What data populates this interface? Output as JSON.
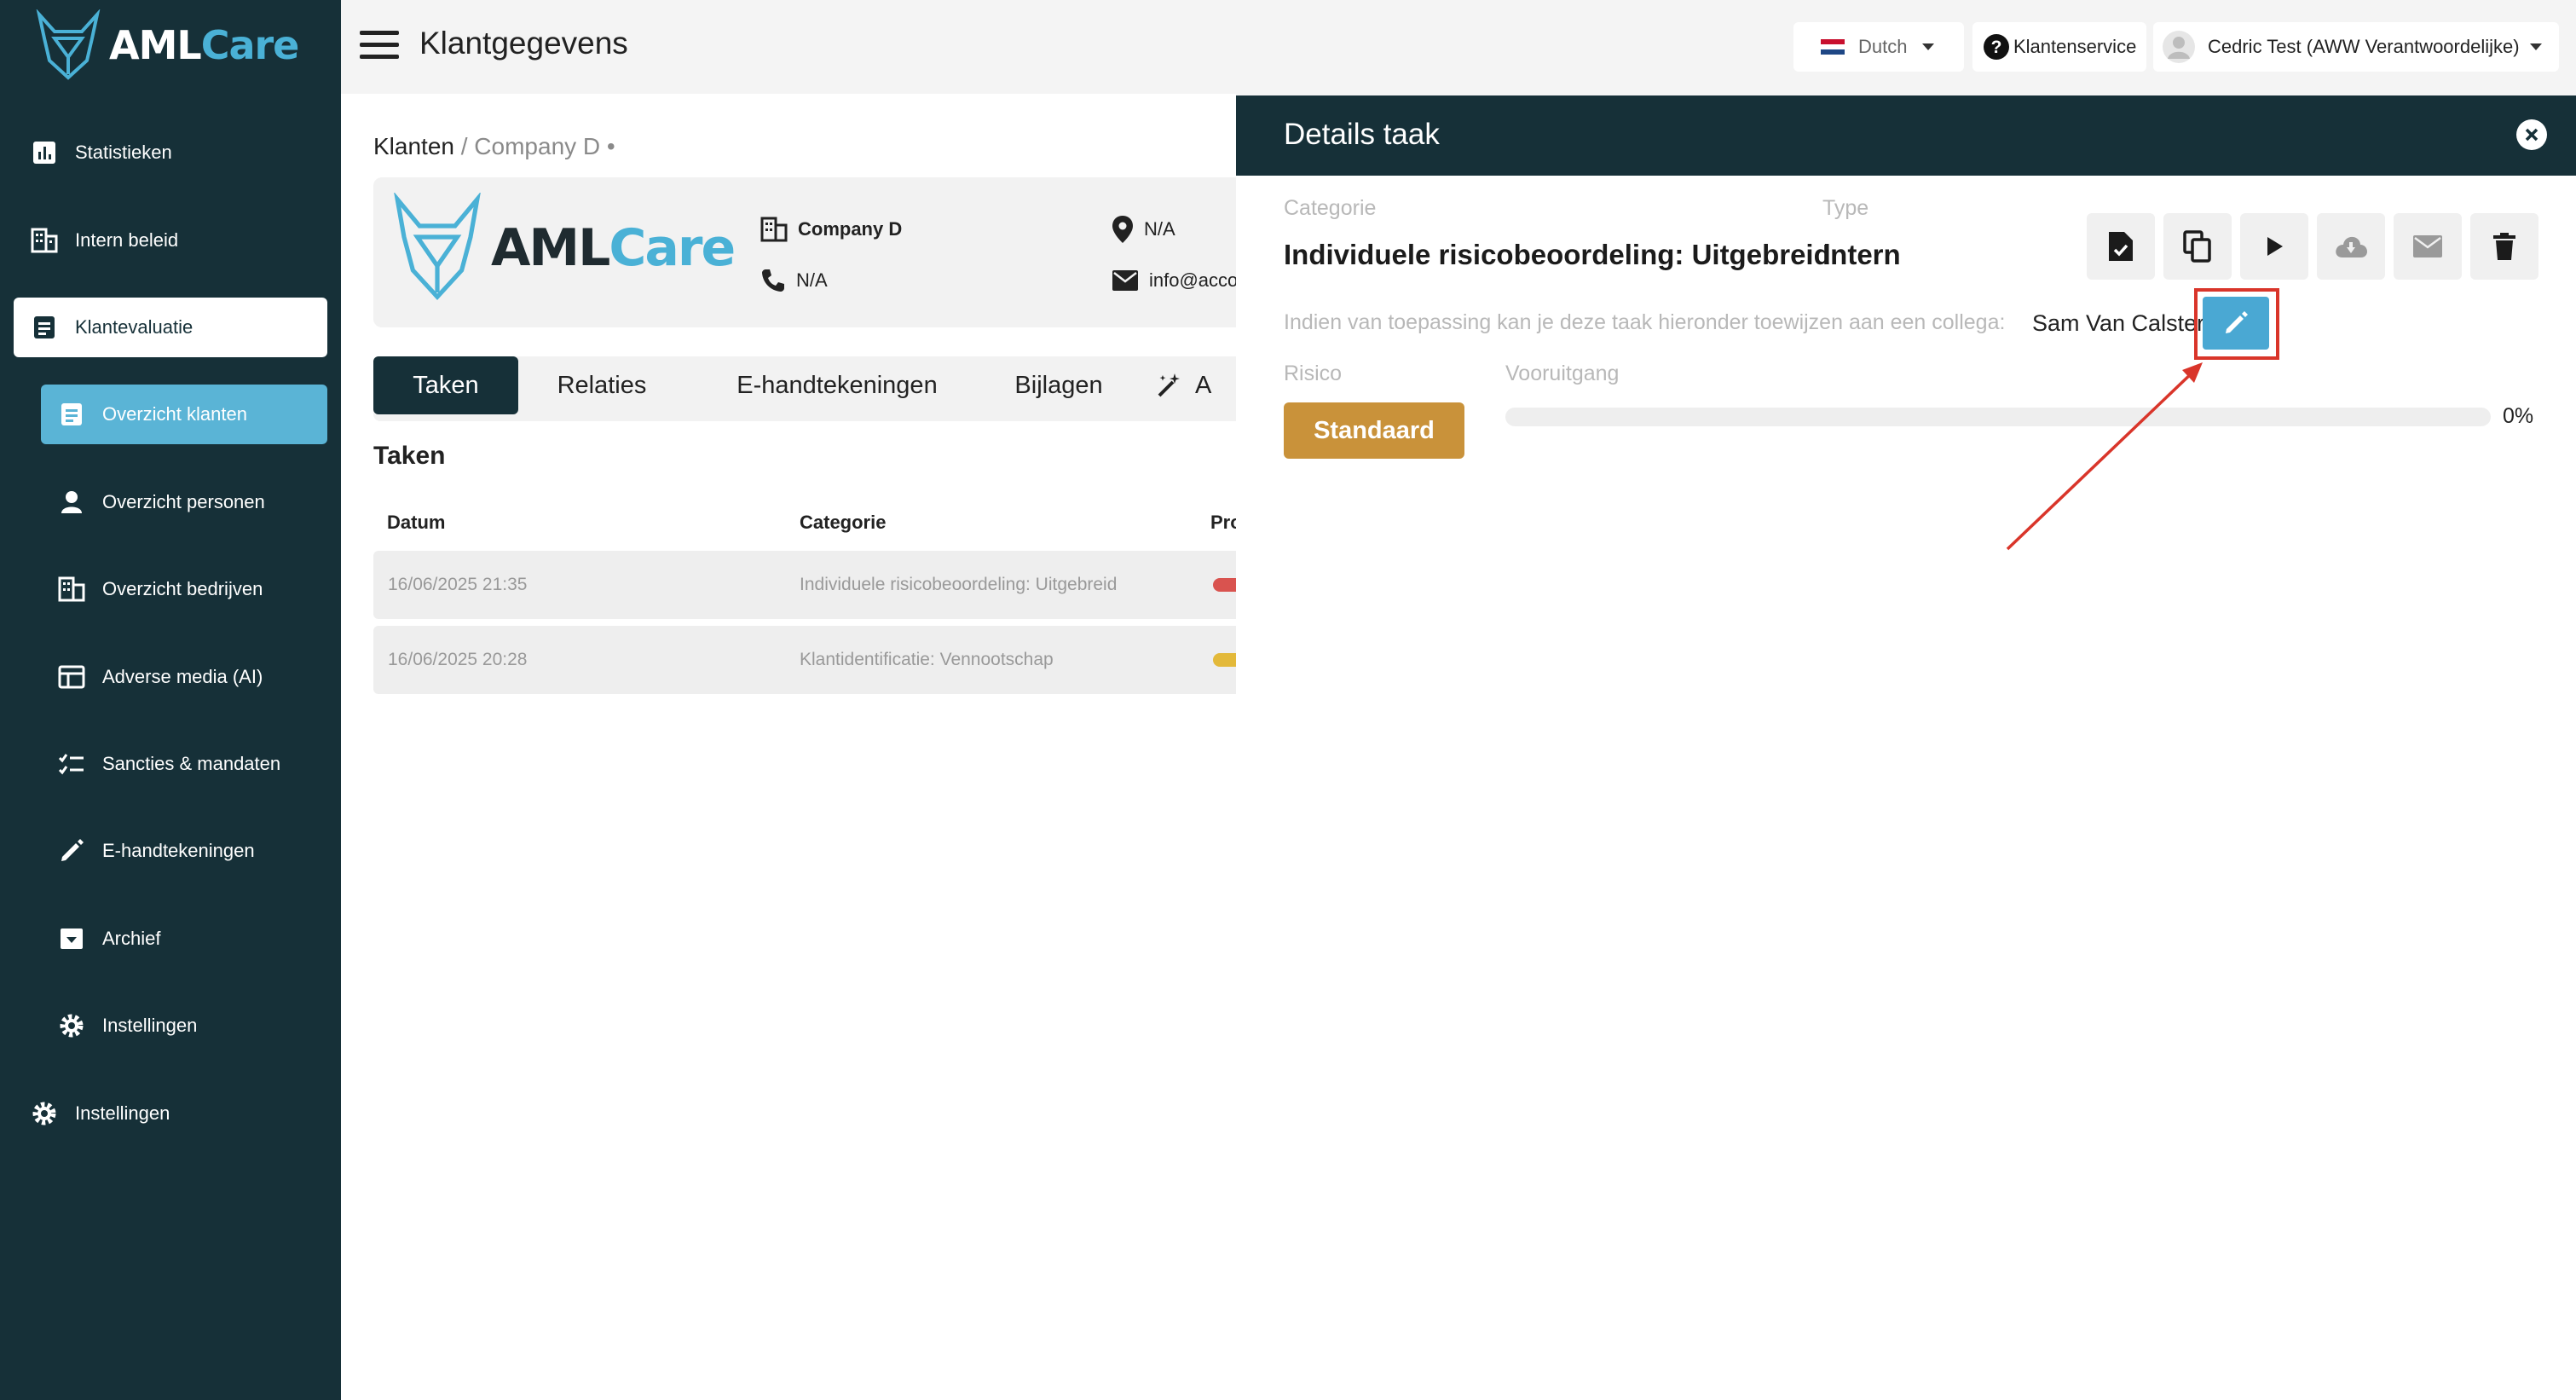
{
  "brand": {
    "name_part1": "AML",
    "name_part2": "Care"
  },
  "sidebar": {
    "items": [
      {
        "label": "Statistieken",
        "icon": "bar-chart-icon"
      },
      {
        "label": "Intern beleid",
        "icon": "building-icon"
      },
      {
        "label": "Klantevaluatie",
        "icon": "document-icon",
        "active": true
      },
      {
        "label": "Overzicht klanten",
        "icon": "list-document-icon",
        "active": true
      },
      {
        "label": "Overzicht personen",
        "icon": "person-icon"
      },
      {
        "label": "Overzicht bedrijven",
        "icon": "building-icon"
      },
      {
        "label": "Adverse media (AI)",
        "icon": "table-icon"
      },
      {
        "label": "Sancties & mandaten",
        "icon": "checklist-icon"
      },
      {
        "label": "E-handtekeningen",
        "icon": "pencil-icon"
      },
      {
        "label": "Archief",
        "icon": "archive-icon"
      },
      {
        "label": "Instellingen",
        "icon": "gear-icon"
      },
      {
        "label": "Instellingen",
        "icon": "gear-icon"
      }
    ]
  },
  "topbar": {
    "title": "Klantgegevens",
    "language": "Dutch",
    "support": "Klantenservice",
    "user": "Cedric Test (AWW Verantwoordelijke)"
  },
  "main": {
    "breadcrumb": {
      "root": "Klanten",
      "current": "/ Company D •"
    },
    "company": {
      "name": "Company D",
      "phone": "N/A",
      "location": "N/A",
      "email": "info@acco"
    },
    "tabs": [
      {
        "label": "Taken",
        "active": true
      },
      {
        "label": "Relaties"
      },
      {
        "label": "E-handtekeningen"
      },
      {
        "label": "Bijlagen"
      },
      {
        "label": "A"
      }
    ],
    "section_title": "Taken",
    "table": {
      "headers": [
        "Datum",
        "Categorie",
        "Pro"
      ],
      "rows": [
        {
          "date": "16/06/2025 21:35",
          "category": "Individuele risicobeoordeling: Uitgebreid",
          "status_color": "#d9534f"
        },
        {
          "date": "16/06/2025 20:28",
          "category": "Klantidentificatie: Vennootschap",
          "status_color": "#e3b93a"
        }
      ]
    }
  },
  "panel": {
    "title": "Details taak",
    "category_label": "Categorie",
    "category_value": "Individuele risicobeoordeling: Uitgebreid",
    "type_label": "Type",
    "type_value": "Intern",
    "assign_text": "Indien van toepassing kan je deze taak hieronder toewijzen aan een collega:",
    "assignee": "Sam Van Calster",
    "risk_label": "Risico",
    "risk_value": "Standaard",
    "progress_label": "Vooruitgang",
    "progress_value": 0,
    "progress_text": "0%",
    "actions": [
      "file-check-icon",
      "copy-icon",
      "play-icon",
      "cloud-download-icon",
      "mail-icon",
      "trash-icon"
    ]
  },
  "colors": {
    "sidebar_bg": "#163038",
    "accent": "#4aa8d3",
    "risk": "#c9923a",
    "highlight": "#d9352a"
  }
}
